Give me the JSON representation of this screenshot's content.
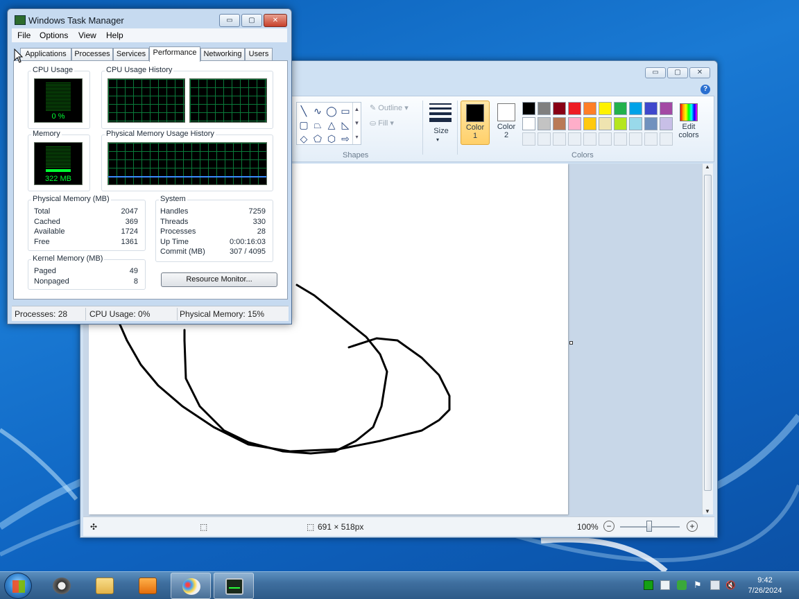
{
  "paint": {
    "window_controls": {
      "minimize": "▭",
      "maximize": "▢",
      "close": "✕"
    },
    "help": "?",
    "shapes_label": "Shapes",
    "outline_label": "Outline",
    "fill_label": "Fill",
    "size_label": "Size",
    "color1_label": "Color\n1",
    "color1_line1": "Color",
    "color1_line2": "1",
    "color2_line1": "Color",
    "color2_line2": "2",
    "colors_label": "Colors",
    "edit_colors_line1": "Edit",
    "edit_colors_line2": "colors",
    "palette_row1": [
      "#000000",
      "#7f7f7f",
      "#880015",
      "#ed1c24",
      "#ff7f27",
      "#fff200",
      "#22b14c",
      "#00a2e8",
      "#3f48cc",
      "#a349a4"
    ],
    "palette_row2": [
      "#ffffff",
      "#c3c3c3",
      "#b97a57",
      "#ffaec9",
      "#ffc90e",
      "#efe4b0",
      "#b5e61d",
      "#99d9ea",
      "#7092be",
      "#c8bfe7"
    ],
    "status": {
      "move_icon": "✣",
      "select_icon": "⬚",
      "canvas_size": "691 × 518px",
      "zoom": "100%",
      "zoom_out": "−",
      "zoom_in": "+"
    }
  },
  "task_manager": {
    "title": "Windows Task Manager",
    "window_controls": {
      "minimize": "▭",
      "maximize": "▢",
      "close": "✕"
    },
    "menu": [
      "File",
      "Options",
      "View",
      "Help"
    ],
    "tabs": [
      "Applications",
      "Processes",
      "Services",
      "Performance",
      "Networking",
      "Users"
    ],
    "active_tab": "Performance",
    "cpu_usage_label": "CPU Usage",
    "cpu_usage_value": "0 %",
    "cpu_history_label": "CPU Usage History",
    "memory_label": "Memory",
    "memory_value": "322 MB",
    "memory_history_label": "Physical Memory Usage History",
    "physical_memory": {
      "title": "Physical Memory (MB)",
      "rows": [
        {
          "label": "Total",
          "value": "2047"
        },
        {
          "label": "Cached",
          "value": "369"
        },
        {
          "label": "Available",
          "value": "1724"
        },
        {
          "label": "Free",
          "value": "1361"
        }
      ]
    },
    "kernel_memory": {
      "title": "Kernel Memory (MB)",
      "rows": [
        {
          "label": "Paged",
          "value": "49"
        },
        {
          "label": "Nonpaged",
          "value": "8"
        }
      ]
    },
    "system": {
      "title": "System",
      "rows": [
        {
          "label": "Handles",
          "value": "7259"
        },
        {
          "label": "Threads",
          "value": "330"
        },
        {
          "label": "Processes",
          "value": "28"
        },
        {
          "label": "Up Time",
          "value": "0:00:16:03"
        },
        {
          "label": "Commit (MB)",
          "value": "307 / 4095"
        }
      ]
    },
    "resource_monitor_button": "Resource Monitor...",
    "status": {
      "processes": "Processes: 28",
      "cpu_usage": "CPU Usage: 0%",
      "physical_memory": "Physical Memory: 15%"
    }
  },
  "taskbar": {
    "clock_time": "9:42",
    "clock_date": "7/26/2024"
  }
}
